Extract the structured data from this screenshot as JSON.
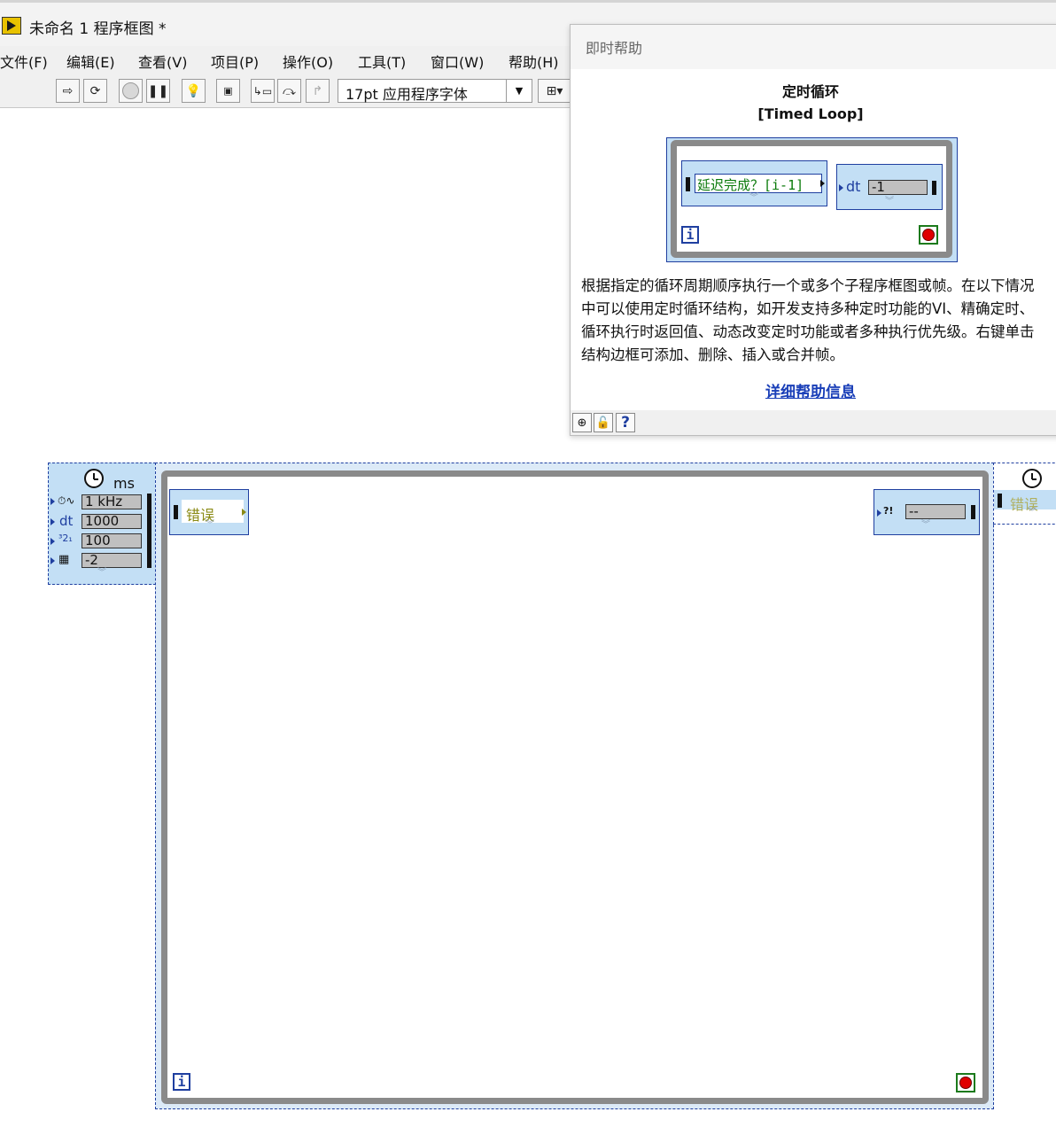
{
  "window": {
    "title": "未命名 1 程序框图 *"
  },
  "menu": {
    "items": [
      "文件(F)",
      "编辑(E)",
      "查看(V)",
      "项目(P)",
      "操作(O)",
      "工具(T)",
      "窗口(W)",
      "帮助(H)"
    ]
  },
  "toolbar": {
    "buttons": [
      "run-arrow-icon",
      "run-continuously-icon",
      "abort-icon",
      "pause-icon",
      "highlight-execution-icon",
      "retain-wire-values-icon",
      "step-into-icon",
      "step-over-icon",
      "step-out-icon",
      "align-objects-icon"
    ],
    "font_select_value": "17pt 应用程序字体"
  },
  "context_help": {
    "window_title": "即时帮助",
    "heading_cn": "定时循环",
    "heading_en": "[Timed Loop]",
    "preview": {
      "left_node_text": "延迟完成？[i-1]",
      "right_node_label": "dt",
      "right_node_value": "-1",
      "iteration_label": "i"
    },
    "description": "根据指定的循环周期顺序执行一个或多个子程序框图或帧。在以下情况中可以使用定时循环结构，如开发支持多种定时功能的VI、精确定时、循环执行时返回值、动态改变定时功能或者多种执行优先级。右键单击结构边框可添加、删除、插入或合并帧。",
    "link_text": "详细帮助信息",
    "footer_buttons": [
      "show-optional-terminals-icon",
      "lock-icon",
      "help-icon"
    ],
    "help_button_label": "?"
  },
  "diagram": {
    "input_node": {
      "unit_label": "ms",
      "rows": [
        {
          "icon": "source-clock-icon",
          "value": "1 kHz"
        },
        {
          "label": "dt",
          "value": "1000"
        },
        {
          "icon": "priority-icon",
          "value": "100"
        },
        {
          "icon": "processor-icon",
          "value": "-2"
        }
      ]
    },
    "left_data_node_text": "错误",
    "right_data_node_text": "--",
    "output_node_text": "错误",
    "iteration_label": "i"
  }
}
